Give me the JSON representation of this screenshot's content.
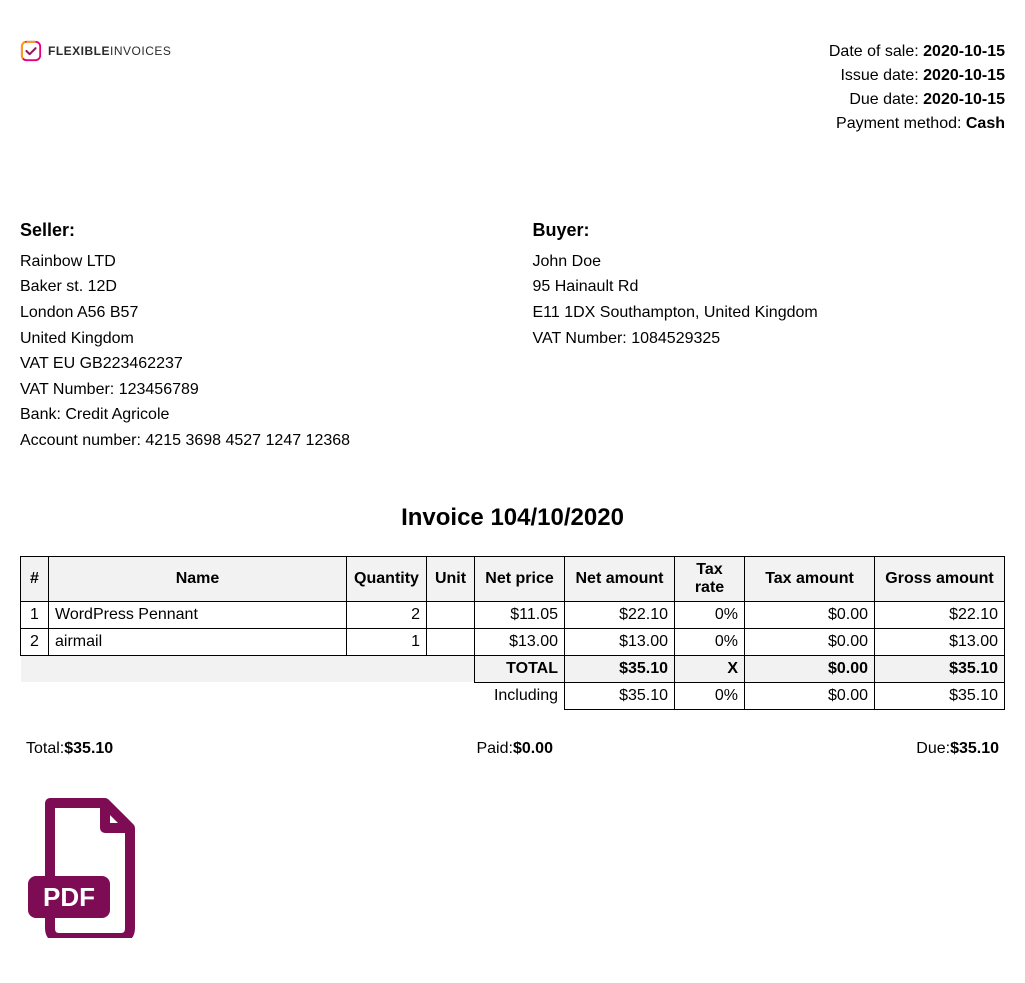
{
  "logo": {
    "bold": "FLEXIBLE",
    "light": "INVOICES"
  },
  "meta": {
    "date_of_sale_label": "Date of sale: ",
    "date_of_sale": "2020-10-15",
    "issue_date_label": "Issue date: ",
    "issue_date": "2020-10-15",
    "due_date_label": "Due date: ",
    "due_date": "2020-10-15",
    "payment_method_label": "Payment method: ",
    "payment_method": "Cash"
  },
  "seller": {
    "heading": "Seller:",
    "lines": [
      "Rainbow LTD",
      "Baker st. 12D",
      "London A56 B57",
      "United Kingdom",
      "VAT EU GB223462237",
      "VAT Number: 123456789",
      "Bank: Credit Agricole",
      "Account number: 4215 3698 4527 1247 12368"
    ]
  },
  "buyer": {
    "heading": "Buyer:",
    "lines": [
      "John Doe",
      "95 Hainault Rd",
      "E11 1DX Southampton, United Kingdom",
      "VAT Number: 1084529325"
    ]
  },
  "invoice_title": "Invoice 104/10/2020",
  "columns": [
    "#",
    "Name",
    "Quantity",
    "Unit",
    "Net price",
    "Net amount",
    "Tax rate",
    "Tax amount",
    "Gross amount"
  ],
  "rows": [
    {
      "num": "1",
      "name": "WordPress Pennant",
      "qty": "2",
      "unit": "",
      "net_price": "$11.05",
      "net_amount": "$22.10",
      "tax_rate": "0%",
      "tax_amount": "$0.00",
      "gross": "$22.10"
    },
    {
      "num": "2",
      "name": "airmail",
      "qty": "1",
      "unit": "",
      "net_price": "$13.00",
      "net_amount": "$13.00",
      "tax_rate": "0%",
      "tax_amount": "$0.00",
      "gross": "$13.00"
    }
  ],
  "total_row": {
    "label": "TOTAL",
    "net_amount": "$35.10",
    "tax_rate": "X",
    "tax_amount": "$0.00",
    "gross": "$35.10"
  },
  "including_row": {
    "label": "Including",
    "net_amount": "$35.10",
    "tax_rate": "0%",
    "tax_amount": "$0.00",
    "gross": "$35.10"
  },
  "summary": {
    "total_label": "Total:",
    "total_value": "$35.10",
    "paid_label": "Paid:",
    "paid_value": "$0.00",
    "due_label": "Due:",
    "due_value": "$35.10"
  },
  "pdf_label": "PDF"
}
